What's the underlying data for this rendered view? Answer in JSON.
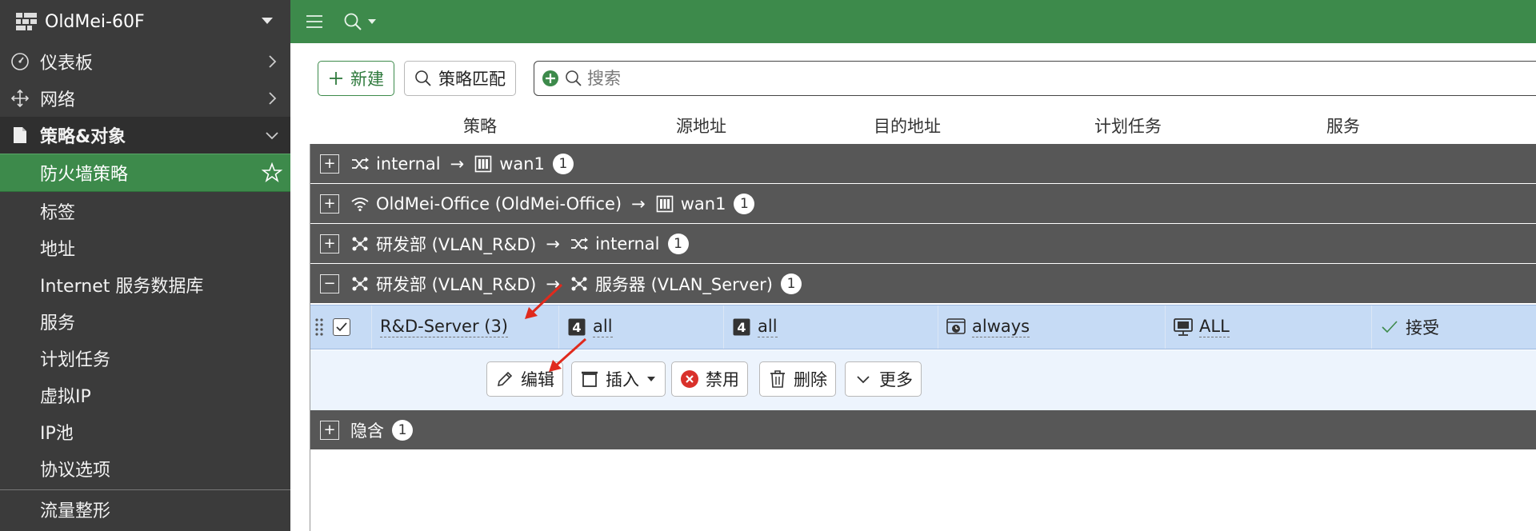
{
  "sidebar": {
    "device_name": "OldMei-60F",
    "items": [
      {
        "label": "仪表板"
      },
      {
        "label": "网络"
      },
      {
        "label": "策略&对象"
      },
      {
        "label": "防火墙策略"
      },
      {
        "label": "标签"
      },
      {
        "label": "地址"
      },
      {
        "label": "Internet 服务数据库"
      },
      {
        "label": "服务"
      },
      {
        "label": "计划任务"
      },
      {
        "label": "虚拟IP"
      },
      {
        "label": "IP池"
      },
      {
        "label": "协议选项"
      },
      {
        "label": "流量整形"
      }
    ]
  },
  "toolbar": {
    "new_label": "新建",
    "match_label": "策略匹配",
    "search_placeholder": "搜索"
  },
  "table": {
    "columns": [
      "策略",
      "源地址",
      "目的地址",
      "计划任务",
      "服务"
    ],
    "groups": [
      {
        "src": "internal",
        "arrow": "→",
        "dst": "wan1",
        "count": "1"
      },
      {
        "src": "OldMei-Office (OldMei-Office)",
        "arrow": "→",
        "dst": "wan1",
        "count": "1"
      },
      {
        "src": "研发部 (VLAN_R&D)",
        "arrow": "→",
        "dst": "internal",
        "count": "1"
      },
      {
        "src": "研发部 (VLAN_R&D)",
        "arrow": "→",
        "dst": "服务器 (VLAN_Server)",
        "count": "1"
      },
      {
        "src": "隐含",
        "count": "1"
      }
    ],
    "row": {
      "policy": "R&D-Server (3)",
      "source": "all",
      "source_badge": "4",
      "destination": "all",
      "destination_badge": "4",
      "schedule": "always",
      "service": "ALL",
      "action": "接受"
    },
    "row_actions": {
      "edit": "编辑",
      "insert": "插入",
      "disable": "禁用",
      "delete": "删除",
      "more": "更多"
    }
  },
  "colors": {
    "brand_green": "#3d8a4b",
    "sidebar_bg": "#3b3b3b",
    "group_bg": "#575757",
    "selected_row": "#c6dbf5",
    "annotation_arrow": "#e02a1d"
  }
}
